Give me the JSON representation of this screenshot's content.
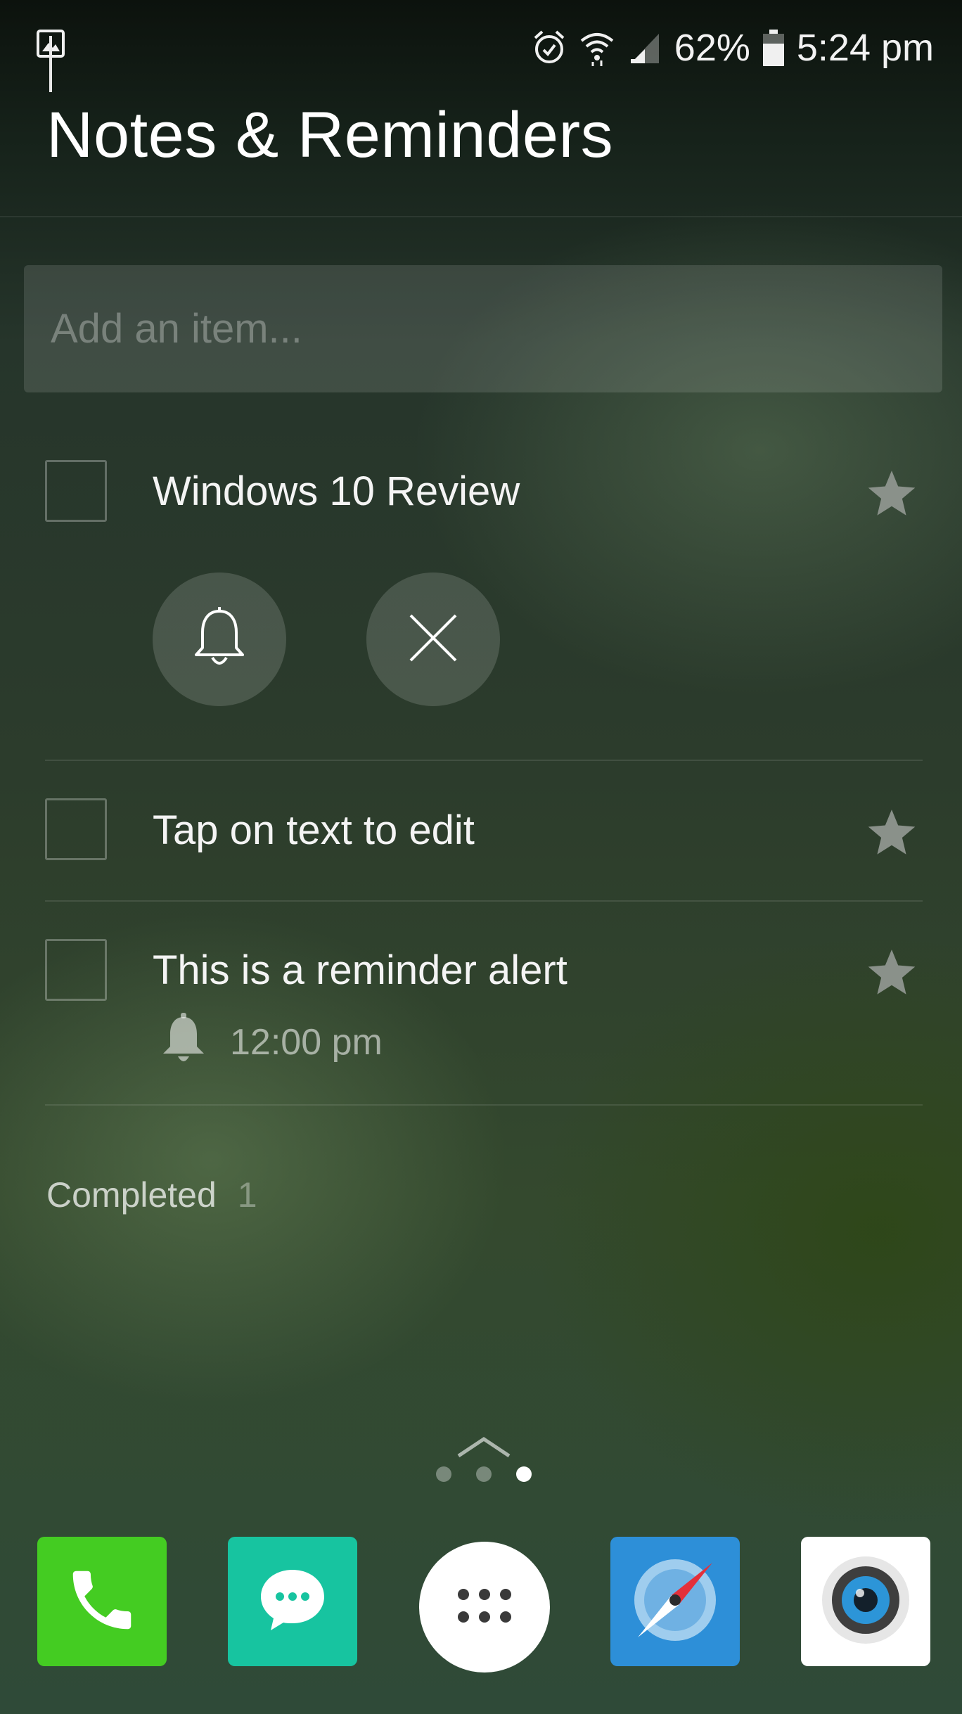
{
  "status_bar": {
    "left_icon": "gallery-icon",
    "icons": [
      "alarm-icon",
      "wifi-icon",
      "signal-icon"
    ],
    "battery_percent": "62%",
    "battery_icon": "battery-icon",
    "time": "5:24 pm"
  },
  "app": {
    "title": "Notes & Reminders"
  },
  "add_item": {
    "value": "",
    "placeholder": "Add an item..."
  },
  "tasks": [
    {
      "text": "Windows 10 Review",
      "checked": false,
      "expanded": true,
      "actions": [
        "bell-outline-icon",
        "close-icon"
      ]
    },
    {
      "text": "Tap on text to edit",
      "checked": false
    },
    {
      "text": "This is a reminder alert",
      "checked": false,
      "reminder_icon": "bell-icon",
      "reminder_time": "12:00 pm"
    }
  ],
  "completed": {
    "label": "Completed",
    "count": "1"
  },
  "page_indicator": {
    "pages": 3,
    "active_index": 2
  },
  "dock": [
    {
      "name": "phone",
      "icon": "phone-icon",
      "color": "#44cc22"
    },
    {
      "name": "messages",
      "icon": "chat-icon",
      "color": "#17c4a0"
    },
    {
      "name": "apps",
      "icon": "app-drawer-icon",
      "color": "#ffffff"
    },
    {
      "name": "browser",
      "icon": "compass-icon",
      "color": "#2d8fd8"
    },
    {
      "name": "camera",
      "icon": "camera-icon",
      "color": "#ffffff"
    }
  ],
  "colors": {
    "star": "#8a918a",
    "phone": "#44cc22",
    "messages": "#17c4a0",
    "browser": "#2d8fd8"
  }
}
